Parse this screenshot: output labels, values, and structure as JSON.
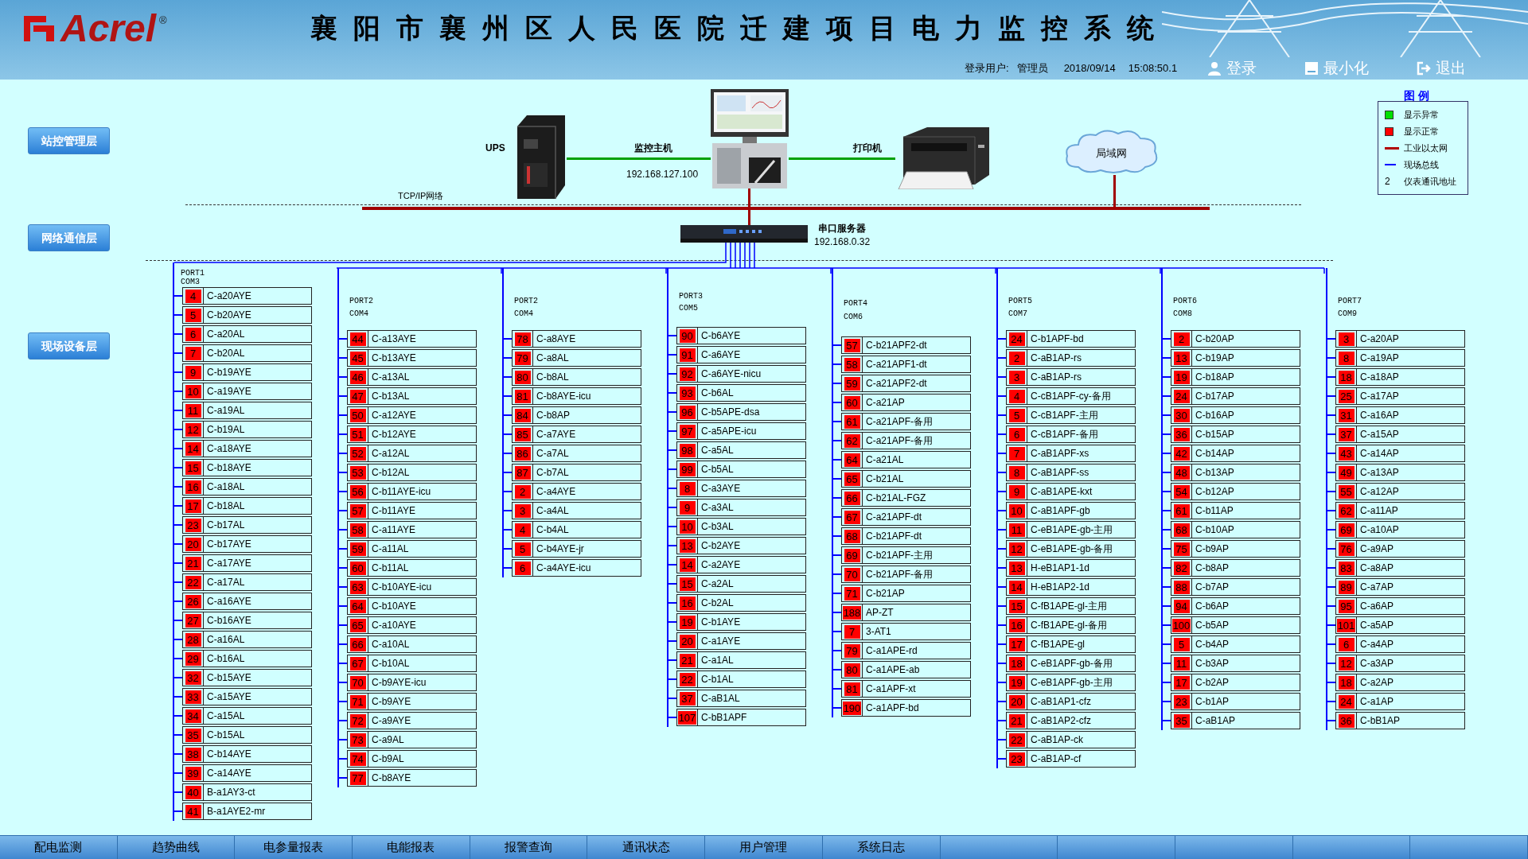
{
  "header": {
    "logo": "Acrel",
    "registered": "®",
    "title": "襄阳市襄州区人民医院迁建项目电力监控系统",
    "user_label": "登录用户:",
    "user": "管理员",
    "date": "2018/09/14",
    "time": "15:08:50.1",
    "buttons": [
      {
        "kind": "login",
        "label": "登录"
      },
      {
        "kind": "minimize",
        "label": "最小化"
      },
      {
        "kind": "exit",
        "label": "退出"
      }
    ]
  },
  "layers": [
    "站控管理层",
    "网络通信层",
    "现场设备层"
  ],
  "network": {
    "ups_label": "UPS",
    "host_label": "监控主机",
    "host_ip": "192.168.127.100",
    "printer_label": "打印机",
    "lan_label": "局域网",
    "tcpip_label": "TCP/IP网络",
    "server_label": "串口服务器",
    "server_ip": "192.168.0.32"
  },
  "legend": {
    "title": "图 例",
    "items": [
      {
        "kind": "green-square",
        "label": "显示异常"
      },
      {
        "kind": "red-square",
        "label": "显示正常"
      },
      {
        "kind": "red-line",
        "label": "工业以太网"
      },
      {
        "kind": "blue-line",
        "label": "现场总线"
      },
      {
        "kind": "number",
        "symbol": "2",
        "label": "仪表通讯地址"
      }
    ]
  },
  "ports": [
    {
      "port": "PORT1",
      "com": "COM3",
      "devices": [
        {
          "address": "4",
          "name": "C-a20AYE",
          "alarm": false
        },
        {
          "address": "5",
          "name": "C-b20AYE",
          "alarm": false
        },
        {
          "address": "6",
          "name": "C-a20AL",
          "alarm": false
        },
        {
          "address": "7",
          "name": "C-b20AL",
          "alarm": false
        },
        {
          "address": "9",
          "name": "C-b19AYE",
          "alarm": false
        },
        {
          "address": "10",
          "name": "C-a19AYE",
          "alarm": false
        },
        {
          "address": "11",
          "name": "C-a19AL",
          "alarm": false
        },
        {
          "address": "12",
          "name": "C-b19AL",
          "alarm": false
        },
        {
          "address": "14",
          "name": "C-a18AYE",
          "alarm": false
        },
        {
          "address": "15",
          "name": "C-b18AYE",
          "alarm": false
        },
        {
          "address": "16",
          "name": "C-a18AL",
          "alarm": false
        },
        {
          "address": "17",
          "name": "C-b18AL",
          "alarm": false
        },
        {
          "address": "23",
          "name": "C-b17AL",
          "alarm": false
        },
        {
          "address": "20",
          "name": "C-b17AYE",
          "alarm": false
        },
        {
          "address": "21",
          "name": "C-a17AYE",
          "alarm": false
        },
        {
          "address": "22",
          "name": "C-a17AL",
          "alarm": false
        },
        {
          "address": "26",
          "name": "C-a16AYE",
          "alarm": false
        },
        {
          "address": "27",
          "name": "C-b16AYE",
          "alarm": false
        },
        {
          "address": "28",
          "name": "C-a16AL",
          "alarm": false
        },
        {
          "address": "29",
          "name": "C-b16AL",
          "alarm": false
        },
        {
          "address": "32",
          "name": "C-b15AYE",
          "alarm": false
        },
        {
          "address": "33",
          "name": "C-a15AYE",
          "alarm": false
        },
        {
          "address": "34",
          "name": "C-a15AL",
          "alarm": false
        },
        {
          "address": "35",
          "name": "C-b15AL",
          "alarm": false
        },
        {
          "address": "38",
          "name": "C-b14AYE",
          "alarm": false
        },
        {
          "address": "39",
          "name": "C-a14AYE",
          "alarm": false
        },
        {
          "address": "40",
          "name": "B-a1AY3-ct",
          "alarm": false
        },
        {
          "address": "41",
          "name": "B-a1AYE2-mr",
          "alarm": false
        }
      ]
    },
    {
      "port": "PORT2",
      "com": "COM4",
      "devices": [
        {
          "address": "44",
          "name": "C-a13AYE",
          "alarm": false
        },
        {
          "address": "45",
          "name": "C-b13AYE",
          "alarm": false
        },
        {
          "address": "46",
          "name": "C-a13AL",
          "alarm": false
        },
        {
          "address": "47",
          "name": "C-b13AL",
          "alarm": false
        },
        {
          "address": "50",
          "name": "C-a12AYE",
          "alarm": false
        },
        {
          "address": "51",
          "name": "C-b12AYE",
          "alarm": false
        },
        {
          "address": "52",
          "name": "C-a12AL",
          "alarm": false
        },
        {
          "address": "53",
          "name": "C-b12AL",
          "alarm": false
        },
        {
          "address": "56",
          "name": "C-b11AYE-icu",
          "alarm": false
        },
        {
          "address": "57",
          "name": "C-b11AYE",
          "alarm": false
        },
        {
          "address": "58",
          "name": "C-a11AYE",
          "alarm": false
        },
        {
          "address": "59",
          "name": "C-a11AL",
          "alarm": false
        },
        {
          "address": "60",
          "name": "C-b11AL",
          "alarm": false
        },
        {
          "address": "63",
          "name": "C-b10AYE-icu",
          "alarm": false
        },
        {
          "address": "64",
          "name": "C-b10AYE",
          "alarm": false
        },
        {
          "address": "65",
          "name": "C-a10AYE",
          "alarm": false
        },
        {
          "address": "66",
          "name": "C-a10AL",
          "alarm": false
        },
        {
          "address": "67",
          "name": "C-b10AL",
          "alarm": false
        },
        {
          "address": "70",
          "name": "C-b9AYE-icu",
          "alarm": false
        },
        {
          "address": "71",
          "name": "C-b9AYE",
          "alarm": false
        },
        {
          "address": "72",
          "name": "C-a9AYE",
          "alarm": false
        },
        {
          "address": "73",
          "name": "C-a9AL",
          "alarm": false
        },
        {
          "address": "74",
          "name": "C-b9AL",
          "alarm": false
        },
        {
          "address": "77",
          "name": "C-b8AYE",
          "alarm": false
        }
      ]
    },
    {
      "port": "PORT2",
      "com": "COM4",
      "devices": [
        {
          "address": "78",
          "name": "C-a8AYE",
          "alarm": false
        },
        {
          "address": "79",
          "name": "C-a8AL",
          "alarm": false
        },
        {
          "address": "80",
          "name": "C-b8AL",
          "alarm": false
        },
        {
          "address": "81",
          "name": "C-b8AYE-icu",
          "alarm": false
        },
        {
          "address": "84",
          "name": "C-b8AP",
          "alarm": false
        },
        {
          "address": "85",
          "name": "C-a7AYE",
          "alarm": false
        },
        {
          "address": "86",
          "name": "C-a7AL",
          "alarm": false
        },
        {
          "address": "87",
          "name": "C-b7AL",
          "alarm": false
        },
        {
          "address": "2",
          "name": "C-a4AYE",
          "alarm": false
        },
        {
          "address": "3",
          "name": "C-a4AL",
          "alarm": false
        },
        {
          "address": "4",
          "name": "C-b4AL",
          "alarm": false
        },
        {
          "address": "5",
          "name": "C-b4AYE-jr",
          "alarm": false
        },
        {
          "address": "6",
          "name": "C-a4AYE-icu",
          "alarm": false
        }
      ]
    },
    {
      "port": "PORT3",
      "com": "COM5",
      "devices": [
        {
          "address": "90",
          "name": "C-b6AYE",
          "alarm": false
        },
        {
          "address": "91",
          "name": "C-a6AYE",
          "alarm": false
        },
        {
          "address": "92",
          "name": "C-a6AYE-nicu",
          "alarm": false
        },
        {
          "address": "93",
          "name": "C-b6AL",
          "alarm": false
        },
        {
          "address": "96",
          "name": "C-b5APE-dsa",
          "alarm": false
        },
        {
          "address": "97",
          "name": "C-a5APE-icu",
          "alarm": false
        },
        {
          "address": "98",
          "name": "C-a5AL",
          "alarm": false
        },
        {
          "address": "99",
          "name": "C-b5AL",
          "alarm": false
        },
        {
          "address": "8",
          "name": "C-a3AYE",
          "alarm": false
        },
        {
          "address": "9",
          "name": "C-a3AL",
          "alarm": false
        },
        {
          "address": "10",
          "name": "C-b3AL",
          "alarm": false
        },
        {
          "address": "13",
          "name": "C-b2AYE",
          "alarm": false
        },
        {
          "address": "14",
          "name": "C-a2AYE",
          "alarm": false
        },
        {
          "address": "15",
          "name": "C-a2AL",
          "alarm": false
        },
        {
          "address": "16",
          "name": "C-b2AL",
          "alarm": false
        },
        {
          "address": "19",
          "name": "C-b1AYE",
          "alarm": false
        },
        {
          "address": "20",
          "name": "C-a1AYE",
          "alarm": false
        },
        {
          "address": "21",
          "name": "C-a1AL",
          "alarm": false
        },
        {
          "address": "22",
          "name": "C-b1AL",
          "alarm": false
        },
        {
          "address": "37",
          "name": "C-aB1AL",
          "alarm": false
        },
        {
          "address": "107",
          "name": "C-bB1APF",
          "alarm": false
        }
      ]
    },
    {
      "port": "PORT4",
      "com": "COM6",
      "devices": [
        {
          "address": "57",
          "name": "C-b21APF2-dt",
          "alarm": false
        },
        {
          "address": "58",
          "name": "C-a21APF1-dt",
          "alarm": false
        },
        {
          "address": "59",
          "name": "C-a21APF2-dt",
          "alarm": false
        },
        {
          "address": "60",
          "name": "C-a21AP",
          "alarm": false
        },
        {
          "address": "61",
          "name": "C-a21APF-备用",
          "alarm": false
        },
        {
          "address": "62",
          "name": "C-a21APF-备用",
          "alarm": false
        },
        {
          "address": "64",
          "name": "C-a21AL",
          "alarm": false
        },
        {
          "address": "65",
          "name": "C-b21AL",
          "alarm": false
        },
        {
          "address": "66",
          "name": "C-b21AL-FGZ",
          "alarm": false
        },
        {
          "address": "67",
          "name": "C-a21APF-dt",
          "alarm": false
        },
        {
          "address": "68",
          "name": "C-b21APF-dt",
          "alarm": false
        },
        {
          "address": "69",
          "name": "C-b21APF-主用",
          "alarm": false
        },
        {
          "address": "70",
          "name": "C-b21APF-备用",
          "alarm": false
        },
        {
          "address": "71",
          "name": "C-b21AP",
          "alarm": false
        },
        {
          "address": "188",
          "name": "AP-ZT",
          "alarm": false
        },
        {
          "address": "7",
          "name": "3-AT1",
          "alarm": false
        },
        {
          "address": "79",
          "name": "C-a1APE-rd",
          "alarm": false
        },
        {
          "address": "80",
          "name": "C-a1APE-ab",
          "alarm": false
        },
        {
          "address": "81",
          "name": "C-a1APF-xt",
          "alarm": false
        },
        {
          "address": "190",
          "name": "C-a1APF-bd",
          "alarm": false
        }
      ]
    },
    {
      "port": "PORT5",
      "com": "COM7",
      "devices": [
        {
          "address": "24",
          "name": "C-b1APF-bd",
          "alarm": false
        },
        {
          "address": "2",
          "name": "C-aB1AP-rs",
          "alarm": false
        },
        {
          "address": "3",
          "name": "C-aB1AP-rs",
          "alarm": false
        },
        {
          "address": "4",
          "name": "C-cB1APF-cy-备用",
          "alarm": false
        },
        {
          "address": "5",
          "name": "C-cB1APF-主用",
          "alarm": false
        },
        {
          "address": "6",
          "name": "C-cB1APF-备用",
          "alarm": false
        },
        {
          "address": "7",
          "name": "C-aB1APF-xs",
          "alarm": false
        },
        {
          "address": "8",
          "name": "C-aB1APF-ss",
          "alarm": false
        },
        {
          "address": "9",
          "name": "C-aB1APE-kxt",
          "alarm": false
        },
        {
          "address": "10",
          "name": "C-aB1APF-gb",
          "alarm": false
        },
        {
          "address": "11",
          "name": "C-eB1APE-gb-主用",
          "alarm": false
        },
        {
          "address": "12",
          "name": "C-eB1APE-gb-备用",
          "alarm": false
        },
        {
          "address": "13",
          "name": "H-eB1AP1-1d",
          "alarm": false
        },
        {
          "address": "14",
          "name": "H-eB1AP2-1d",
          "alarm": false
        },
        {
          "address": "15",
          "name": "C-fB1APE-gl-主用",
          "alarm": false
        },
        {
          "address": "16",
          "name": "C-fB1APE-gl-备用",
          "alarm": false
        },
        {
          "address": "17",
          "name": "C-fB1APE-gl",
          "alarm": false
        },
        {
          "address": "18",
          "name": "C-eB1APF-gb-备用",
          "alarm": false
        },
        {
          "address": "19",
          "name": "C-eB1APF-gb-主用",
          "alarm": false
        },
        {
          "address": "20",
          "name": "C-aB1AP1-cfz",
          "alarm": false
        },
        {
          "address": "21",
          "name": "C-aB1AP2-cfz",
          "alarm": false
        },
        {
          "address": "22",
          "name": "C-aB1AP-ck",
          "alarm": false
        },
        {
          "address": "23",
          "name": "C-aB1AP-cf",
          "alarm": false
        }
      ]
    },
    {
      "port": "PORT6",
      "com": "COM8",
      "devices": [
        {
          "address": "2",
          "name": "C-b20AP",
          "alarm": false
        },
        {
          "address": "13",
          "name": "C-b19AP",
          "alarm": false
        },
        {
          "address": "19",
          "name": "C-b18AP",
          "alarm": false
        },
        {
          "address": "24",
          "name": "C-b17AP",
          "alarm": false
        },
        {
          "address": "30",
          "name": "C-b16AP",
          "alarm": false
        },
        {
          "address": "36",
          "name": "C-b15AP",
          "alarm": false
        },
        {
          "address": "42",
          "name": "C-b14AP",
          "alarm": false
        },
        {
          "address": "48",
          "name": "C-b13AP",
          "alarm": false
        },
        {
          "address": "54",
          "name": "C-b12AP",
          "alarm": false
        },
        {
          "address": "61",
          "name": "C-b11AP",
          "alarm": false
        },
        {
          "address": "68",
          "name": "C-b10AP",
          "alarm": false
        },
        {
          "address": "75",
          "name": "C-b9AP",
          "alarm": false
        },
        {
          "address": "82",
          "name": "C-b8AP",
          "alarm": false
        },
        {
          "address": "88",
          "name": "C-b7AP",
          "alarm": false
        },
        {
          "address": "94",
          "name": "C-b6AP",
          "alarm": false
        },
        {
          "address": "100",
          "name": "C-b5AP",
          "alarm": false
        },
        {
          "address": "5",
          "name": "C-b4AP",
          "alarm": false
        },
        {
          "address": "11",
          "name": "C-b3AP",
          "alarm": false
        },
        {
          "address": "17",
          "name": "C-b2AP",
          "alarm": false
        },
        {
          "address": "23",
          "name": "C-b1AP",
          "alarm": false
        },
        {
          "address": "35",
          "name": "C-aB1AP",
          "alarm": false
        }
      ]
    },
    {
      "port": "PORT7",
      "com": "COM9",
      "devices": [
        {
          "address": "3",
          "name": "C-a20AP",
          "alarm": false
        },
        {
          "address": "8",
          "name": "C-a19AP",
          "alarm": false
        },
        {
          "address": "18",
          "name": "C-a18AP",
          "alarm": false
        },
        {
          "address": "25",
          "name": "C-a17AP",
          "alarm": false
        },
        {
          "address": "31",
          "name": "C-a16AP",
          "alarm": false
        },
        {
          "address": "37",
          "name": "C-a15AP",
          "alarm": false
        },
        {
          "address": "43",
          "name": "C-a14AP",
          "alarm": false
        },
        {
          "address": "49",
          "name": "C-a13AP",
          "alarm": false
        },
        {
          "address": "55",
          "name": "C-a12AP",
          "alarm": false
        },
        {
          "address": "62",
          "name": "C-a11AP",
          "alarm": false
        },
        {
          "address": "69",
          "name": "C-a10AP",
          "alarm": false
        },
        {
          "address": "76",
          "name": "C-a9AP",
          "alarm": false
        },
        {
          "address": "83",
          "name": "C-a8AP",
          "alarm": false
        },
        {
          "address": "89",
          "name": "C-a7AP",
          "alarm": false
        },
        {
          "address": "95",
          "name": "C-a6AP",
          "alarm": false
        },
        {
          "address": "101",
          "name": "C-a5AP",
          "alarm": false
        },
        {
          "address": "6",
          "name": "C-a4AP",
          "alarm": false
        },
        {
          "address": "12",
          "name": "C-a3AP",
          "alarm": false
        },
        {
          "address": "18",
          "name": "C-a2AP",
          "alarm": false
        },
        {
          "address": "24",
          "name": "C-a1AP",
          "alarm": false
        },
        {
          "address": "36",
          "name": "C-bB1AP",
          "alarm": false
        }
      ]
    }
  ],
  "nav": [
    "配电监测",
    "趋势曲线",
    "电参量报表",
    "电能报表",
    "报警查询",
    "通讯状态",
    "用户管理",
    "系统日志"
  ]
}
